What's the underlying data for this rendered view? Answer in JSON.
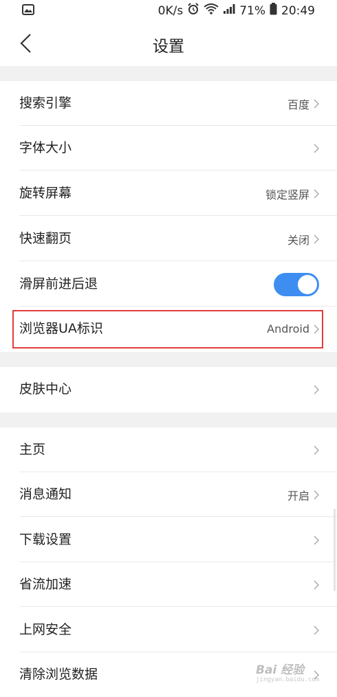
{
  "status_bar": {
    "net_speed": "0K/s",
    "battery_percent": "71%",
    "time": "20:49",
    "icons": [
      "image-notification-icon",
      "alarm-icon",
      "wifi-icon",
      "signal-icon",
      "battery-icon"
    ]
  },
  "header": {
    "title": "设置",
    "back_icon": "chevron-left-icon"
  },
  "settings": {
    "items": [
      {
        "label": "搜索引擎",
        "value": "百度"
      },
      {
        "label": "字体大小",
        "value": ""
      },
      {
        "label": "旋转屏幕",
        "value": "锁定竖屏"
      },
      {
        "label": "快速翻页",
        "value": "关闭"
      },
      {
        "label": "滑屏前进后退",
        "toggle_on": true
      },
      {
        "label": "浏览器UA标识",
        "value": "Android",
        "highlighted": true
      },
      {
        "label": "皮肤中心",
        "value": ""
      },
      {
        "label": "主页",
        "value": ""
      },
      {
        "label": "消息通知",
        "value": "开启"
      },
      {
        "label": "下载设置",
        "value": ""
      },
      {
        "label": "省流加速",
        "value": ""
      },
      {
        "label": "上网安全",
        "value": ""
      },
      {
        "label": "清除浏览数据",
        "value": ""
      }
    ]
  },
  "colors": {
    "accent": "#3e8ef2",
    "highlight_border": "#e23c3c",
    "section_gap": "#f1f1f1"
  },
  "watermark": {
    "text": "Bai 经验",
    "sub": "jingyan.baidu.com"
  }
}
